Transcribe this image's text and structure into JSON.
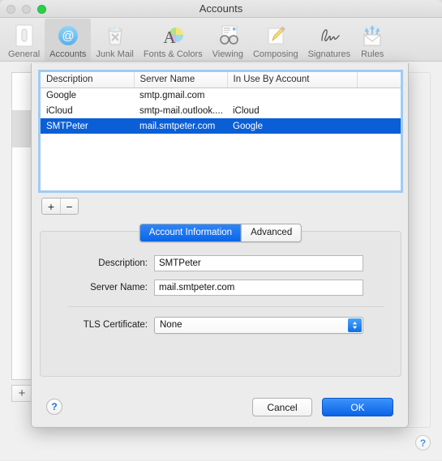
{
  "window": {
    "title": "Accounts",
    "traffic_lights": [
      "close-button",
      "minimize-button",
      "zoom-button"
    ]
  },
  "toolbar": {
    "items": [
      {
        "label": "General",
        "icon": "general-icon",
        "selected": false
      },
      {
        "label": "Accounts",
        "icon": "accounts-at-icon",
        "selected": true
      },
      {
        "label": "Junk Mail",
        "icon": "junk-mail-icon",
        "selected": false
      },
      {
        "label": "Fonts & Colors",
        "icon": "fonts-colors-icon",
        "selected": false
      },
      {
        "label": "Viewing",
        "icon": "viewing-icon",
        "selected": false
      },
      {
        "label": "Composing",
        "icon": "composing-icon",
        "selected": false
      },
      {
        "label": "Signatures",
        "icon": "signatures-icon",
        "selected": false
      },
      {
        "label": "Rules",
        "icon": "rules-icon",
        "selected": false
      }
    ]
  },
  "background": {
    "accounts": [
      {
        "icon": "icloud-icon",
        "selected": false
      },
      {
        "icon": "google-icon",
        "selected": true
      }
    ],
    "add_label": "+",
    "help_label": "?"
  },
  "sheet": {
    "table": {
      "columns": [
        "Description",
        "Server Name",
        "In Use By Account",
        ""
      ],
      "rows": [
        {
          "description": "Google",
          "server": "smtp.gmail.com",
          "in_use_by": "",
          "selected": false
        },
        {
          "description": "iCloud",
          "server": "smtp-mail.outlook....",
          "in_use_by": "iCloud",
          "selected": false
        },
        {
          "description": "SMTPeter",
          "server": "mail.smtpeter.com",
          "in_use_by": "Google",
          "selected": true
        }
      ]
    },
    "list_controls": {
      "add_label": "+",
      "remove_label": "−"
    },
    "tabs": [
      {
        "label": "Account Information",
        "active": true
      },
      {
        "label": "Advanced",
        "active": false
      }
    ],
    "fields": [
      {
        "label": "Description:",
        "value": "SMTPeter",
        "placeholder": ""
      },
      {
        "label": "Server Name:",
        "value": "mail.smtpeter.com",
        "placeholder": ""
      }
    ],
    "popup": {
      "label": "TLS Certificate:",
      "value": "None"
    },
    "footer": {
      "help_label": "?",
      "cancel_label": "Cancel",
      "ok_label": "OK"
    }
  },
  "colors": {
    "selection_blue": "#0b5fd6",
    "accent_blue": "#0b63e6",
    "focus_ring": "#9fcbf5",
    "window_bg": "#ececec"
  }
}
